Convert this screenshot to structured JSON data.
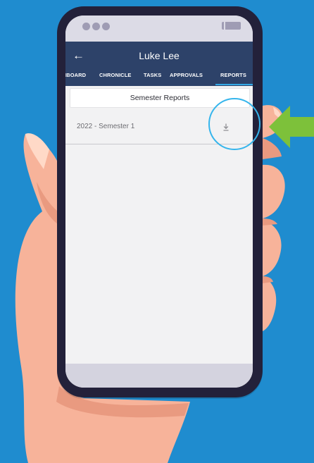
{
  "colors": {
    "background": "#1f8ccf",
    "phone_frame": "#23213a",
    "header": "#2d4269",
    "accent_tab": "#33a9e6",
    "arrow_green": "#7dc13a",
    "highlight_ring": "#35b5ec",
    "skin": "#f8b59a"
  },
  "header": {
    "back_icon": "arrow-left-icon",
    "back_glyph": "←",
    "title": "Luke Lee"
  },
  "tabs": [
    {
      "label": "IBOARD"
    },
    {
      "label": "CHRONICLE"
    },
    {
      "label": "TASKS"
    },
    {
      "label": "APPROVALS"
    },
    {
      "label": "REPORTS",
      "active": true
    }
  ],
  "section": {
    "title": "Semester Reports"
  },
  "reports": [
    {
      "label": "2022 - Semester 1",
      "action_icon": "download-icon"
    }
  ]
}
